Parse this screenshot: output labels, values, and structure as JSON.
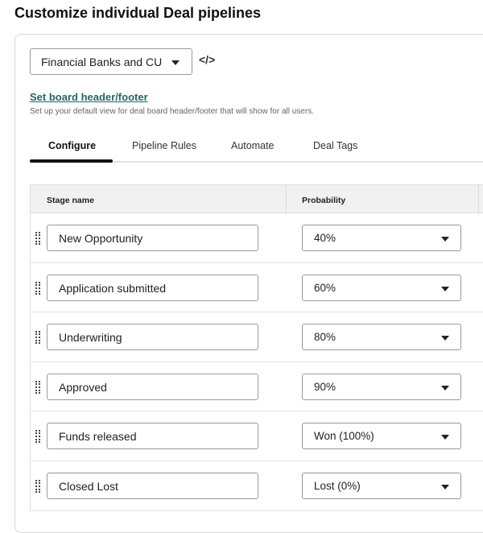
{
  "title": "Customize individual Deal pipelines",
  "pipeline_select": {
    "value": "Financial Banks and CU"
  },
  "code_icon": "</>",
  "board": {
    "link": "Set board header/footer",
    "description": "Set up your default view for deal board header/footer that will show for all users."
  },
  "tabs": [
    {
      "label": "Configure",
      "active": true
    },
    {
      "label": "Pipeline Rules"
    },
    {
      "label": "Automate"
    },
    {
      "label": "Deal Tags"
    }
  ],
  "table": {
    "headers": [
      "Stage name",
      "Probability"
    ],
    "rows": [
      {
        "stage": "New Opportunity",
        "probability": "40%"
      },
      {
        "stage": "Application submitted",
        "probability": "60%"
      },
      {
        "stage": "Underwriting",
        "probability": "80%"
      },
      {
        "stage": "Approved",
        "probability": "90%"
      },
      {
        "stage": "Funds released",
        "probability": "Won (100%)"
      },
      {
        "stage": "Closed Lost",
        "probability": "Lost (0%)"
      }
    ]
  },
  "colors": {
    "link": "#1d6b66",
    "header_bg": "#f1f1f1"
  }
}
